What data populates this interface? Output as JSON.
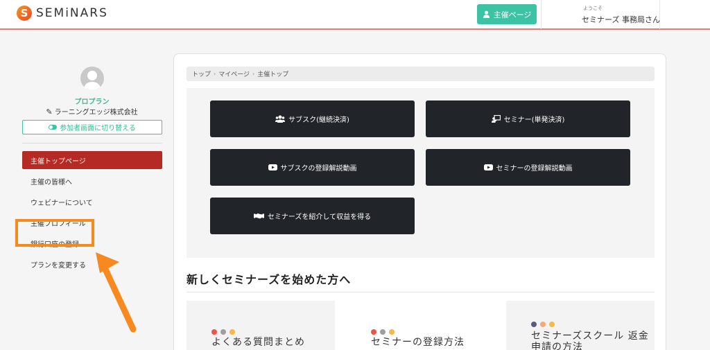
{
  "header": {
    "logo_mark": "S",
    "logo_text": "SEMiNARS",
    "organizer_button": "主催ページ",
    "welcome": "ようこそ",
    "user_name": "セミナーズ 事務局さん"
  },
  "sidebar": {
    "plan_name": "プロプラン",
    "company": "ラーニングエッジ株式会社",
    "switch_label": "参加者画面に切り替える",
    "items": [
      {
        "label": "主催トップページ",
        "active": true
      },
      {
        "label": "主催の皆様へ"
      },
      {
        "label": "ウェビナーについて"
      },
      {
        "label": "主催プロフィール"
      },
      {
        "label": "銀行口座の登録"
      },
      {
        "label": "プランを変更する"
      }
    ]
  },
  "breadcrumb": [
    "トップ",
    "マイページ",
    "主催トップ"
  ],
  "buttons": {
    "subscription": "サブスク(継続決済)",
    "seminar": "セミナー(単発決済)",
    "subscription_video": "サブスクの登録解説動画",
    "seminar_video": "セミナーの登録解説動画",
    "referral": "セミナーズを紹介して収益を得る"
  },
  "section": {
    "title": "新しくセミナーズを始めた方へ",
    "cards": [
      {
        "title": "よくある質問まとめ",
        "dots": [
          "#ef5350",
          "#9e9e9e",
          "#f6b84b"
        ]
      },
      {
        "title": "セミナーの登録方法",
        "dots": [
          "#ef5350",
          "#9e9e9e",
          "#f6b84b"
        ]
      },
      {
        "title": "セミナーズスクール 返金申請の方法",
        "dots": [
          "#5b5b7a",
          "#f7a97a",
          "#f6b84b"
        ]
      }
    ]
  },
  "colors": {
    "accent_green": "#3cc3a4",
    "active_red": "#b52a25",
    "highlight_orange": "#f7891f",
    "dark_button": "#212529"
  }
}
